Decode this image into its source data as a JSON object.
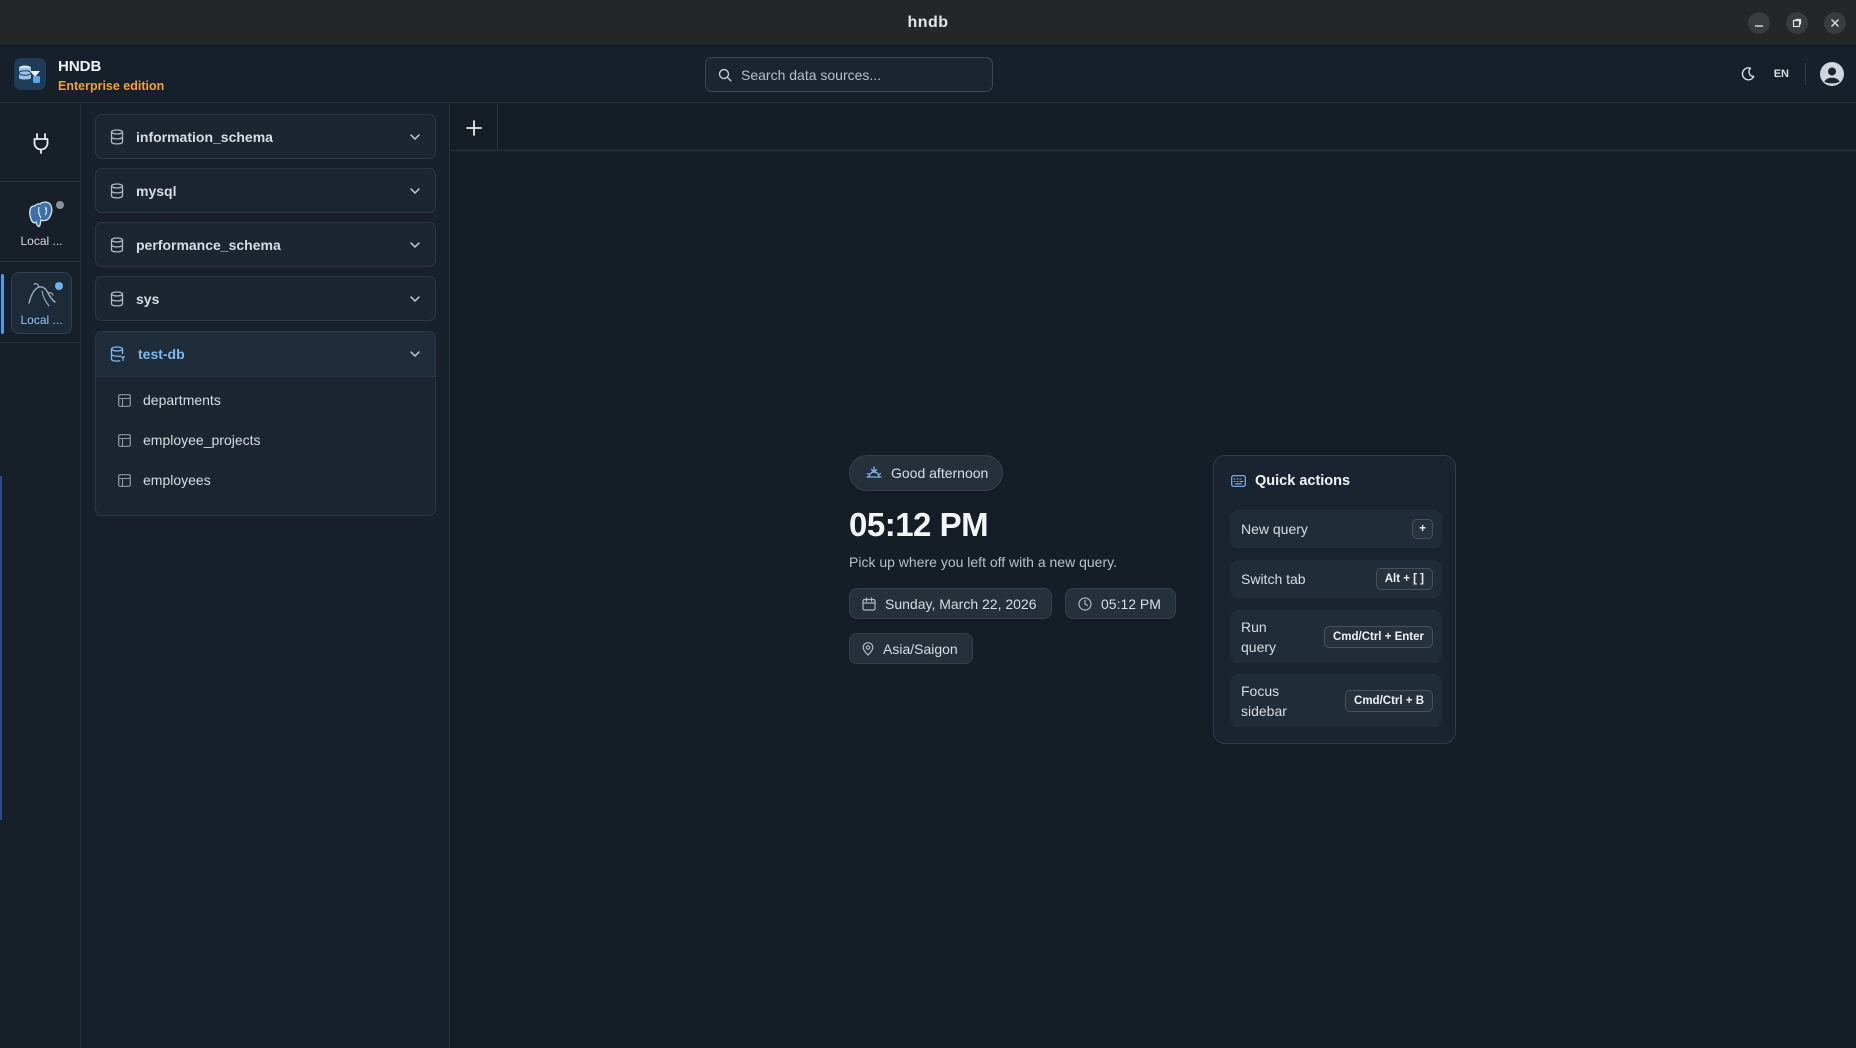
{
  "window": {
    "title": "hndb",
    "controls": [
      "minimize-icon",
      "maximize-icon",
      "close-icon"
    ]
  },
  "header": {
    "brand_name": "HNDB",
    "edition": "Enterprise edition",
    "search_placeholder": "Search data sources...",
    "language": "EN",
    "theme_icon": "moon-icon",
    "avatar_icon": "user-icon"
  },
  "rail": {
    "connections": [
      {
        "label": "Local ...",
        "icon": "postgresql-icon",
        "status_color": "#8a939c",
        "active": false
      },
      {
        "label": "Local ...",
        "icon": "mysql-icon",
        "status_color": "#6fb3ee",
        "active": true
      }
    ]
  },
  "sidebar": {
    "databases": [
      {
        "name": "information_schema",
        "expanded": false
      },
      {
        "name": "mysql",
        "expanded": false
      },
      {
        "name": "performance_schema",
        "expanded": false
      },
      {
        "name": "sys",
        "expanded": false
      },
      {
        "name": "test-db",
        "expanded": true,
        "tables": [
          "departments",
          "employee_projects",
          "employees"
        ]
      }
    ]
  },
  "welcome": {
    "greeting": "Good afternoon",
    "time": "05:12 PM",
    "subtitle": "Pick up where you left off with a new query.",
    "date": "Sunday, March 22, 2026",
    "clock": "05:12 PM",
    "timezone": "Asia/Saigon"
  },
  "quick_actions": {
    "title": "Quick actions",
    "items": [
      {
        "label": "New query",
        "shortcut": "+"
      },
      {
        "label": "Switch tab",
        "shortcut": "Alt + [ ]"
      },
      {
        "label": "Run query",
        "shortcut": "Cmd/Ctrl + Enter"
      },
      {
        "label": "Focus sidebar",
        "shortcut": "Cmd/Ctrl + B"
      }
    ]
  },
  "colors": {
    "background": "#151e27",
    "accent": "#4d9de6",
    "edition": "#f0a52a"
  }
}
